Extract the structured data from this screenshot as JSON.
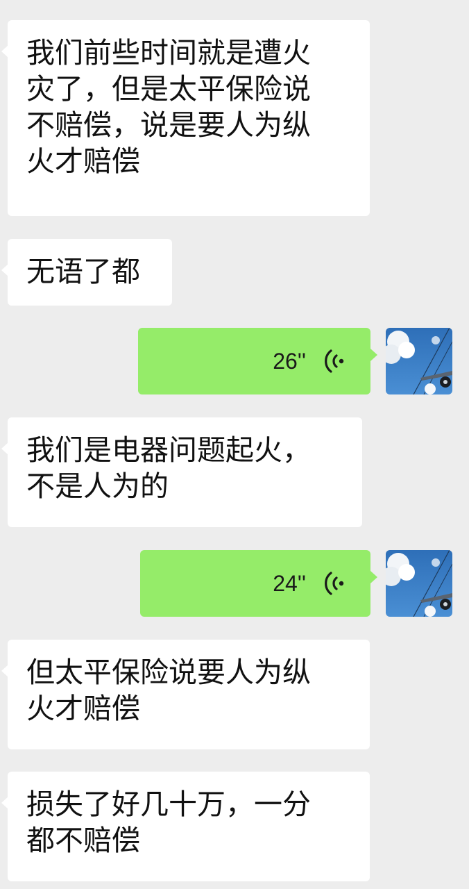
{
  "messages": [
    {
      "text": "我们前些时间就是遭火\n灾了，但是太平保险说\n不赔偿，说是要人为纵\n火才赔偿"
    },
    {
      "text": "无语了都"
    },
    {
      "duration": "26''"
    },
    {
      "text": "我们是电器问题起火，\n不是人为的"
    },
    {
      "duration": "24''"
    },
    {
      "text": "但太平保险说要人为纵\n火才赔偿"
    },
    {
      "text": "损失了好几十万，一分\n都不赔偿"
    }
  ],
  "colors": {
    "background": "#ededed",
    "incoming_bubble": "#ffffff",
    "outgoing_bubble": "#95ec69"
  },
  "icons": {
    "voice": "voice-wave-icon",
    "avatar": "sky-photo-avatar"
  }
}
